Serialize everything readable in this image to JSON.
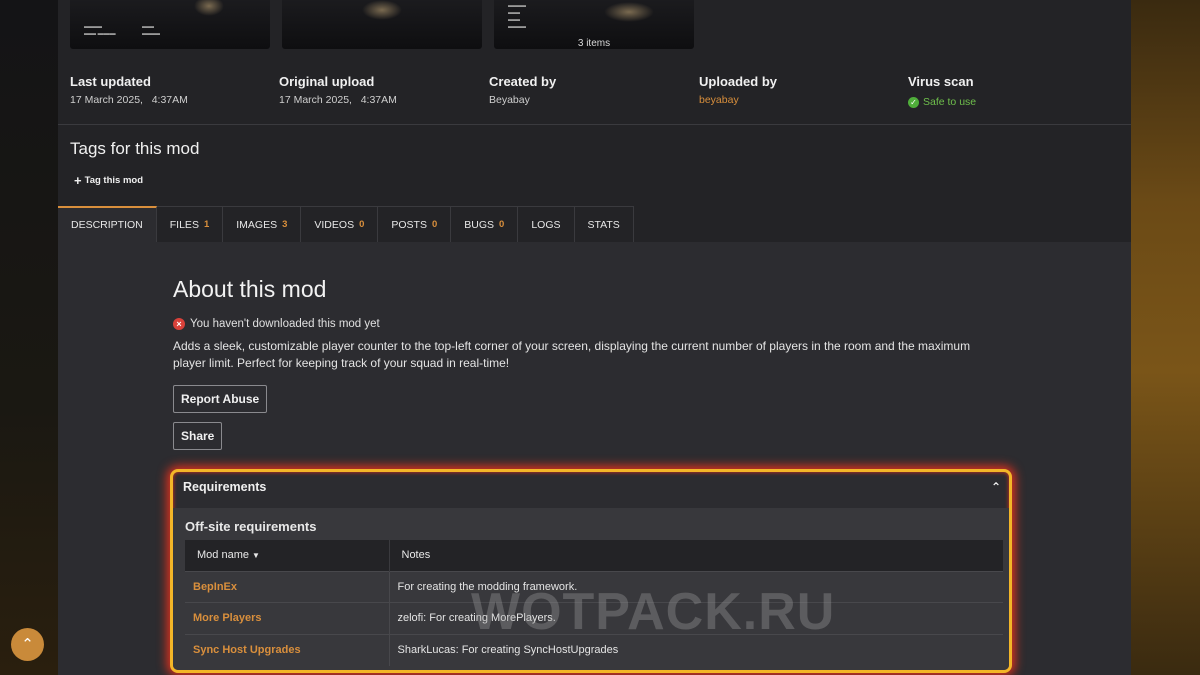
{
  "gallery": {
    "count_label": "3 items"
  },
  "meta": {
    "last_updated": {
      "label": "Last updated",
      "value": "17 March 2025,   4:37AM"
    },
    "original_upload": {
      "label": "Original upload",
      "value": "17 March 2025,   4:37AM"
    },
    "created_by": {
      "label": "Created by",
      "value": "Beyabay"
    },
    "uploaded_by": {
      "label": "Uploaded by",
      "value": "beyabay"
    },
    "virus_scan": {
      "label": "Virus scan",
      "value": "Safe to use"
    }
  },
  "tags": {
    "title": "Tags for this mod",
    "tag_button": "Tag this mod"
  },
  "tabs": [
    {
      "label": "DESCRIPTION",
      "count": ""
    },
    {
      "label": "FILES",
      "count": "1"
    },
    {
      "label": "IMAGES",
      "count": "3"
    },
    {
      "label": "VIDEOS",
      "count": "0"
    },
    {
      "label": "POSTS",
      "count": "0"
    },
    {
      "label": "BUGS",
      "count": "0"
    },
    {
      "label": "LOGS",
      "count": ""
    },
    {
      "label": "STATS",
      "count": ""
    }
  ],
  "about": {
    "title": "About this mod",
    "warning": "You haven't downloaded this mod yet",
    "description": "Adds a sleek, customizable player counter to the top-left corner of your screen, displaying the current number of players in the room and the maximum player limit. Perfect for keeping track of your squad in real-time!",
    "report_button": "Report Abuse",
    "share_button": "Share"
  },
  "requirements": {
    "title": "Requirements",
    "offsite_title": "Off-site requirements",
    "columns": [
      "Mod name",
      "Notes"
    ],
    "rows": [
      {
        "name": "BepInEx",
        "notes": "For creating the modding framework."
      },
      {
        "name": "More Players",
        "notes": "zelofi: For creating MorePlayers."
      },
      {
        "name": "Sync Host Upgrades",
        "notes": "SharkLucas: For creating SyncHostUpgrades"
      }
    ]
  },
  "watermark": "WOTPACK.RU",
  "colors": {
    "accent": "#d98f3c",
    "highlight_border": "#f3b628",
    "safe": "#6fbf4c",
    "error": "#d9413a"
  }
}
